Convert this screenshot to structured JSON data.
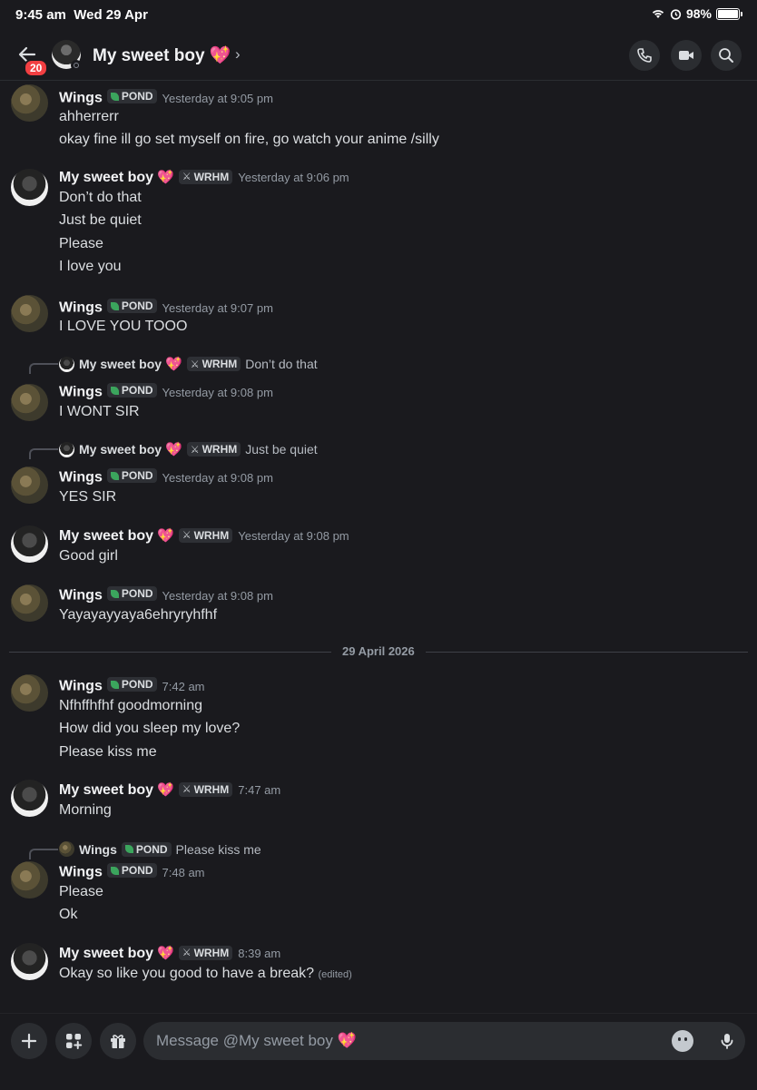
{
  "status_bar": {
    "time": "9:45 am",
    "date": "Wed 29 Apr",
    "battery": "98%"
  },
  "header": {
    "unread_count": "20",
    "title": "My sweet boy 💖",
    "chevron": "›",
    "icons": [
      "back-arrow-icon",
      "phone-icon",
      "video-icon",
      "search-icon"
    ]
  },
  "users": {
    "wings": {
      "name": "Wings",
      "tag": "POND"
    },
    "boy": {
      "name": "My sweet boy",
      "heart": "💖",
      "tag": "WRHM"
    }
  },
  "messages": [
    {
      "author": "Wings",
      "tag": "POND",
      "time": "Yesterday at 9:05 pm",
      "lines": [
        "ahherrerr",
        "okay fine ill go set myself on fire, go watch your anime /silly"
      ]
    },
    {
      "author": "My sweet boy",
      "tag": "WRHM",
      "time": "Yesterday at 9:06 pm",
      "lines": [
        "Don’t do that",
        "Just be quiet",
        "Please",
        "I love you"
      ]
    },
    {
      "author": "Wings",
      "tag": "POND",
      "time": "Yesterday at 9:07 pm",
      "lines": [
        "I LOVE YOU TOOO"
      ]
    },
    {
      "reply": {
        "author": "My sweet boy",
        "tag": "WRHM",
        "text": "Don’t do that"
      },
      "author": "Wings",
      "tag": "POND",
      "time": "Yesterday at 9:08 pm",
      "lines": [
        "I WONT SIR"
      ]
    },
    {
      "reply": {
        "author": "My sweet boy",
        "tag": "WRHM",
        "text": "Just be quiet"
      },
      "author": "Wings",
      "tag": "POND",
      "time": "Yesterday at 9:08 pm",
      "lines": [
        "YES SIR"
      ]
    },
    {
      "author": "My sweet boy",
      "tag": "WRHM",
      "time": "Yesterday at 9:08 pm",
      "lines": [
        "Good girl"
      ]
    },
    {
      "author": "Wings",
      "tag": "POND",
      "time": "Yesterday at 9:08 pm",
      "lines": [
        "Yayayayyaya6ehryryhfhf"
      ]
    },
    {
      "author": "Wings",
      "tag": "POND",
      "time": "7:42 am",
      "lines": [
        "Nfhffhfhf goodmorning",
        "How did you sleep my love?",
        "Please kiss me"
      ]
    },
    {
      "author": "My sweet boy",
      "tag": "WRHM",
      "time": "7:47 am",
      "lines": [
        "Morning"
      ]
    },
    {
      "reply": {
        "author": "Wings",
        "tag": "POND",
        "text": "Please kiss me"
      },
      "author": "Wings",
      "tag": "POND",
      "time": "7:48 am",
      "lines": [
        "Please",
        "Ok"
      ]
    },
    {
      "author": "My sweet boy",
      "tag": "WRHM",
      "time": "8:39 am",
      "lines": [
        "Okay so like you good to have a break?"
      ],
      "edited": "(edited)"
    }
  ],
  "date_divider": "29 April 2026",
  "composer": {
    "placeholder": "Message @My sweet boy 💖"
  }
}
